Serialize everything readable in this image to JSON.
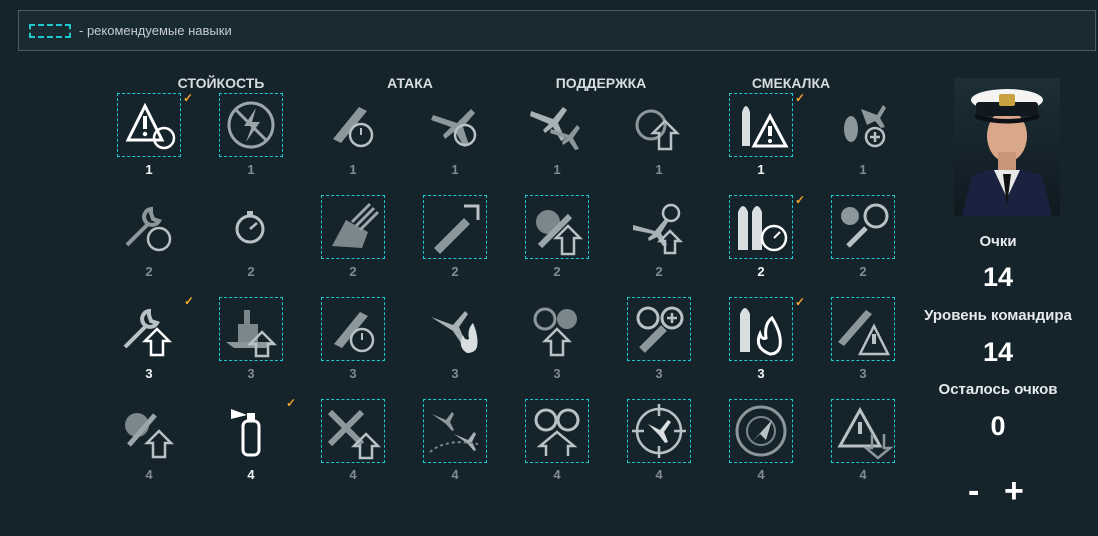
{
  "legend": {
    "text": "- рекомендуемые навыки",
    "border_color": "#1ec8cf"
  },
  "columns": [
    "СТОЙКОСТЬ",
    "АТАКА",
    "ПОДДЕРЖКА",
    "СМЕКАЛКА"
  ],
  "colors": {
    "background": "#15242b",
    "recommended": "#1ec8cf",
    "check": "#f0a32a"
  },
  "rows": [
    {
      "cost": "1",
      "skills": [
        {
          "icon": "warning-circle-icon",
          "recommended": true,
          "check": true,
          "bright": true
        },
        {
          "icon": "no-lightning-icon",
          "recommended": true,
          "check": false,
          "bright": false
        },
        {
          "icon": "torpedo-timer-icon",
          "recommended": false,
          "check": false,
          "bright": false
        },
        {
          "icon": "plane-timer-icon",
          "recommended": false,
          "check": false,
          "bright": false
        },
        {
          "icon": "planes-icon",
          "recommended": false,
          "check": false,
          "bright": false
        },
        {
          "icon": "crew-upgrade-icon",
          "recommended": false,
          "check": false,
          "bright": false
        },
        {
          "icon": "ship-warning-icon",
          "recommended": true,
          "check": true,
          "bright": true
        },
        {
          "icon": "bomb-plane-plus-icon",
          "recommended": false,
          "check": false,
          "bright": false
        }
      ]
    },
    {
      "cost": "2",
      "skills": [
        {
          "icon": "wrench-timer-icon",
          "recommended": false,
          "check": false,
          "bright": false
        },
        {
          "icon": "stopwatch-icon",
          "recommended": false,
          "check": false,
          "bright": false
        },
        {
          "icon": "turret-icon",
          "recommended": true,
          "check": false,
          "bright": false
        },
        {
          "icon": "shell-arrow-icon",
          "recommended": true,
          "check": false,
          "bright": false
        },
        {
          "icon": "explosion-arrow-icon",
          "recommended": true,
          "check": false,
          "bright": false
        },
        {
          "icon": "fighter-arrow-icon",
          "recommended": false,
          "check": false,
          "bright": false
        },
        {
          "icon": "ships-timer-icon",
          "recommended": true,
          "check": true,
          "bright": true
        },
        {
          "icon": "wheel-wrench-icon",
          "recommended": true,
          "check": false,
          "bright": false
        }
      ]
    },
    {
      "cost": "3",
      "skills": [
        {
          "icon": "wrench-arrow-icon",
          "recommended": false,
          "check": true,
          "bright": true
        },
        {
          "icon": "battleship-arrow-icon",
          "recommended": true,
          "check": false,
          "bright": false
        },
        {
          "icon": "torpedo-timer-icon",
          "recommended": true,
          "check": false,
          "bright": false
        },
        {
          "icon": "plane-fire-icon",
          "recommended": false,
          "check": false,
          "bright": false
        },
        {
          "icon": "aa-arrow-icon",
          "recommended": false,
          "check": false,
          "bright": false
        },
        {
          "icon": "heal-plus-icon",
          "recommended": true,
          "check": false,
          "bright": false
        },
        {
          "icon": "ship-fire-icon",
          "recommended": true,
          "check": true,
          "bright": true
        },
        {
          "icon": "torpedo-warning-icon",
          "recommended": true,
          "check": false,
          "bright": false
        }
      ]
    },
    {
      "cost": "4",
      "skills": [
        {
          "icon": "shells-arrow-icon",
          "recommended": false,
          "check": false,
          "bright": false
        },
        {
          "icon": "extinguisher-icon",
          "recommended": false,
          "check": true,
          "bright": true
        },
        {
          "icon": "cross-arrow-icon",
          "recommended": true,
          "check": false,
          "bright": false
        },
        {
          "icon": "planes-map-icon",
          "recommended": true,
          "check": false,
          "bright": false
        },
        {
          "icon": "aa-double-arrow-icon",
          "recommended": true,
          "check": false,
          "bright": false
        },
        {
          "icon": "crosshair-plane-icon",
          "recommended": true,
          "check": false,
          "bright": false
        },
        {
          "icon": "radar-icon",
          "recommended": true,
          "check": false,
          "bright": false
        },
        {
          "icon": "warning-down-icon",
          "recommended": true,
          "check": false,
          "bright": false
        }
      ]
    }
  ],
  "stats": {
    "points_label": "Очки",
    "points_value": "14",
    "level_label": "Уровень командира",
    "level_value": "14",
    "remaining_label": "Осталось очков",
    "remaining_value": "0"
  },
  "controls": {
    "minus": "-",
    "plus": "+"
  }
}
